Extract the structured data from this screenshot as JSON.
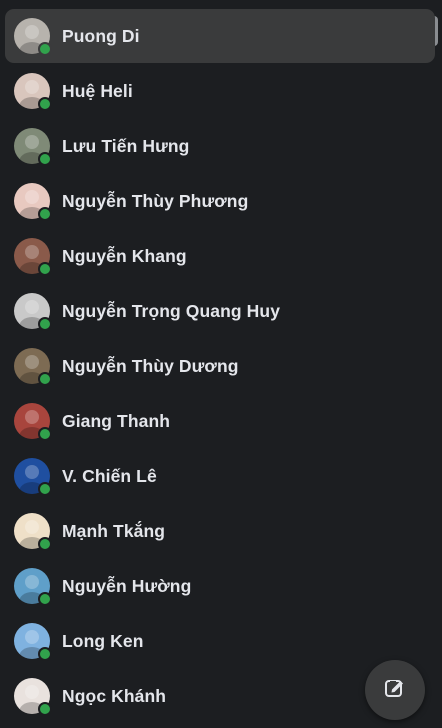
{
  "contacts": [
    {
      "name": "Puong Di",
      "online": true,
      "active": true,
      "avatar_color": "#b7b3ad"
    },
    {
      "name": "Huệ Heli",
      "online": true,
      "active": false,
      "avatar_color": "#d9c6bd"
    },
    {
      "name": "Lưu Tiến Hưng",
      "online": true,
      "active": false,
      "avatar_color": "#7f8a77"
    },
    {
      "name": "Nguyễn Thùy Phương",
      "online": true,
      "active": false,
      "avatar_color": "#e8c9c0"
    },
    {
      "name": "Nguyễn Khang",
      "online": true,
      "active": false,
      "avatar_color": "#8a5a4a"
    },
    {
      "name": "Nguyễn Trọng Quang Huy",
      "online": true,
      "active": false,
      "avatar_color": "#c9c9c9"
    },
    {
      "name": "Nguyễn Thùy Dương",
      "online": true,
      "active": false,
      "avatar_color": "#7d6b53"
    },
    {
      "name": "Giang Thanh",
      "online": true,
      "active": false,
      "avatar_color": "#a8453d"
    },
    {
      "name": "V. Chiến Lê",
      "online": true,
      "active": false,
      "avatar_color": "#1f4fa0"
    },
    {
      "name": "Mạnh Tkắng",
      "online": true,
      "active": false,
      "avatar_color": "#efe0c8"
    },
    {
      "name": "Nguyễn Hường",
      "online": true,
      "active": false,
      "avatar_color": "#5f9fc9"
    },
    {
      "name": "Long Ken",
      "online": true,
      "active": false,
      "avatar_color": "#7fb2e0"
    },
    {
      "name": "Ngọc Khánh",
      "online": true,
      "active": false,
      "avatar_color": "#e9e2de"
    }
  ],
  "compose": {
    "icon": "compose-icon"
  },
  "colors": {
    "background": "#1c1e21",
    "active_row": "#3a3b3c",
    "online": "#31a24c",
    "text": "#e4e6eb"
  }
}
